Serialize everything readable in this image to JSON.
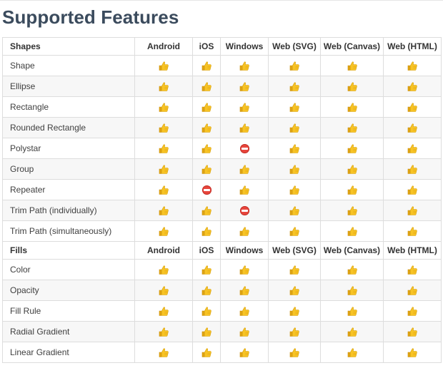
{
  "title": "Supported Features",
  "columns": [
    "Android",
    "iOS",
    "Windows",
    "Web (SVG)",
    "Web (Canvas)",
    "Web (HTML)"
  ],
  "sections": [
    {
      "heading": "Shapes",
      "rows": [
        {
          "name": "Shape",
          "support": [
            "yes",
            "yes",
            "yes",
            "yes",
            "yes",
            "yes"
          ]
        },
        {
          "name": "Ellipse",
          "support": [
            "yes",
            "yes",
            "yes",
            "yes",
            "yes",
            "yes"
          ]
        },
        {
          "name": "Rectangle",
          "support": [
            "yes",
            "yes",
            "yes",
            "yes",
            "yes",
            "yes"
          ]
        },
        {
          "name": "Rounded Rectangle",
          "support": [
            "yes",
            "yes",
            "yes",
            "yes",
            "yes",
            "yes"
          ]
        },
        {
          "name": "Polystar",
          "support": [
            "yes",
            "yes",
            "no",
            "yes",
            "yes",
            "yes"
          ]
        },
        {
          "name": "Group",
          "support": [
            "yes",
            "yes",
            "yes",
            "yes",
            "yes",
            "yes"
          ]
        },
        {
          "name": "Repeater",
          "support": [
            "yes",
            "no",
            "yes",
            "yes",
            "yes",
            "yes"
          ]
        },
        {
          "name": "Trim Path (individually)",
          "support": [
            "yes",
            "yes",
            "no",
            "yes",
            "yes",
            "yes"
          ]
        },
        {
          "name": "Trim Path (simultaneously)",
          "support": [
            "yes",
            "yes",
            "yes",
            "yes",
            "yes",
            "yes"
          ]
        }
      ]
    },
    {
      "heading": "Fills",
      "rows": [
        {
          "name": "Color",
          "support": [
            "yes",
            "yes",
            "yes",
            "yes",
            "yes",
            "yes"
          ]
        },
        {
          "name": "Opacity",
          "support": [
            "yes",
            "yes",
            "yes",
            "yes",
            "yes",
            "yes"
          ]
        },
        {
          "name": "Fill Rule",
          "support": [
            "yes",
            "yes",
            "yes",
            "yes",
            "yes",
            "yes"
          ]
        },
        {
          "name": "Radial Gradient",
          "support": [
            "yes",
            "yes",
            "yes",
            "yes",
            "yes",
            "yes"
          ]
        },
        {
          "name": "Linear Gradient",
          "support": [
            "yes",
            "yes",
            "yes",
            "yes",
            "yes",
            "yes"
          ]
        }
      ]
    }
  ],
  "icons": {
    "yes": "thumbs-up-icon",
    "no": "no-entry-icon"
  },
  "colors": {
    "title": "#3b4b5d",
    "thumb": "#f5b91c",
    "no_entry": "#e8453c"
  }
}
